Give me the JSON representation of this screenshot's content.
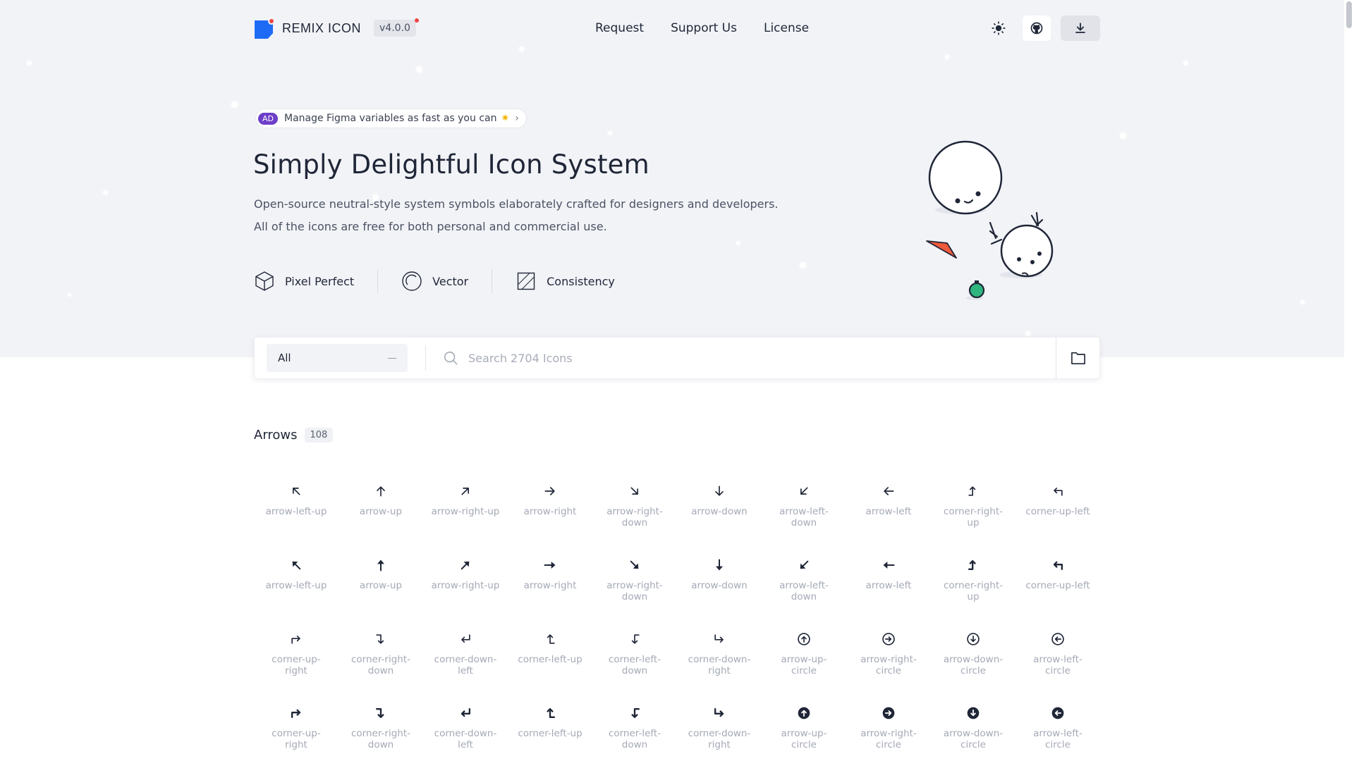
{
  "brand": {
    "name": "REMIX ICON",
    "version": "v4.0.0"
  },
  "nav": {
    "links": [
      "Request",
      "Support Us",
      "License"
    ]
  },
  "ad": {
    "badge": "AD",
    "text": "Manage Figma variables as fast as you can"
  },
  "hero": {
    "title": "Simply Delightful Icon System",
    "desc1": "Open-source neutral-style system symbols elaborately crafted for designers and developers.",
    "desc2": "All of the icons are free for both personal and commercial use."
  },
  "features": [
    {
      "label": "Pixel Perfect",
      "icon": "cube-icon"
    },
    {
      "label": "Vector",
      "icon": "circle-icon"
    },
    {
      "label": "Consistency",
      "icon": "grid-icon"
    }
  ],
  "search": {
    "category": "All",
    "placeholder": "Search 2704 Icons"
  },
  "section": {
    "title": "Arrows",
    "count": "108"
  },
  "colors": {
    "brand_blue": "#1e6cf5",
    "brand_red": "#ef4444",
    "ad_purple": "#6d3ec8",
    "text": "#1f2637",
    "muted": "#a4a9b5"
  },
  "icons": [
    {
      "label": "arrow-left-up",
      "icon": "ul-line"
    },
    {
      "label": "arrow-up",
      "icon": "u-line"
    },
    {
      "label": "arrow-right-up",
      "icon": "ur-line"
    },
    {
      "label": "arrow-right",
      "icon": "r-line"
    },
    {
      "label": "arrow-right-down",
      "icon": "dr-line"
    },
    {
      "label": "arrow-down",
      "icon": "d-line"
    },
    {
      "label": "arrow-left-down",
      "icon": "dl-line"
    },
    {
      "label": "arrow-left",
      "icon": "l-line"
    },
    {
      "label": "corner-right-up",
      "icon": "cru-line"
    },
    {
      "label": "corner-up-left",
      "icon": "cul-line"
    },
    {
      "label": "arrow-left-up",
      "icon": "ul-fill"
    },
    {
      "label": "arrow-up",
      "icon": "u-fill"
    },
    {
      "label": "arrow-right-up",
      "icon": "ur-fill"
    },
    {
      "label": "arrow-right",
      "icon": "r-fill"
    },
    {
      "label": "arrow-right-down",
      "icon": "dr-fill"
    },
    {
      "label": "arrow-down",
      "icon": "d-fill"
    },
    {
      "label": "arrow-left-down",
      "icon": "dl-fill"
    },
    {
      "label": "arrow-left",
      "icon": "l-fill"
    },
    {
      "label": "corner-right-up",
      "icon": "cru-fill"
    },
    {
      "label": "corner-up-left",
      "icon": "cul-fill"
    },
    {
      "label": "corner-up-right",
      "icon": "cur-line"
    },
    {
      "label": "corner-right-down",
      "icon": "crd-line"
    },
    {
      "label": "corner-down-left",
      "icon": "cdl-line"
    },
    {
      "label": "corner-left-up",
      "icon": "clu-line"
    },
    {
      "label": "corner-left-down",
      "icon": "cld-line"
    },
    {
      "label": "corner-down-right",
      "icon": "cdr-line"
    },
    {
      "label": "arrow-up-circle",
      "icon": "circ-u-line"
    },
    {
      "label": "arrow-right-circle",
      "icon": "circ-r-line"
    },
    {
      "label": "arrow-down-circle",
      "icon": "circ-d-line"
    },
    {
      "label": "arrow-left-circle",
      "icon": "circ-l-line"
    },
    {
      "label": "corner-up-right",
      "icon": "cur-fill"
    },
    {
      "label": "corner-right-down",
      "icon": "crd-fill"
    },
    {
      "label": "corner-down-left",
      "icon": "cdl-fill"
    },
    {
      "label": "corner-left-up",
      "icon": "clu-fill"
    },
    {
      "label": "corner-left-down",
      "icon": "cld-fill"
    },
    {
      "label": "corner-down-right",
      "icon": "cdr-fill"
    },
    {
      "label": "arrow-up-circle",
      "icon": "circ-u-fill"
    },
    {
      "label": "arrow-right-circle",
      "icon": "circ-r-fill"
    },
    {
      "label": "arrow-down-circle",
      "icon": "circ-d-fill"
    },
    {
      "label": "arrow-left-circle",
      "icon": "circ-l-fill"
    }
  ]
}
